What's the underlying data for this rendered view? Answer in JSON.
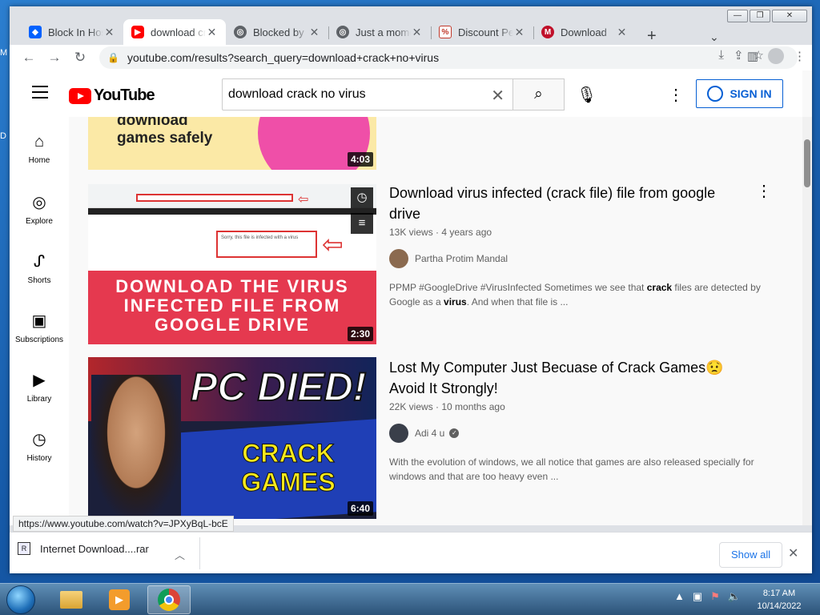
{
  "browser": {
    "tabs": [
      {
        "title": "Block In Host",
        "favicon": "dropbox-icon",
        "active": false
      },
      {
        "title": "download crack no virus",
        "favicon": "youtube-icon",
        "active": true
      },
      {
        "title": "Blocked by",
        "favicon": "globe-icon",
        "active": false
      },
      {
        "title": "Just a moment",
        "favicon": "globe-icon",
        "active": false
      },
      {
        "title": "Discount Pe",
        "favicon": "discount-icon",
        "active": false
      },
      {
        "title": "Download",
        "favicon": "m-icon",
        "active": false
      }
    ],
    "address": "youtube.com/results?search_query=download+crack+no+virus",
    "status_url": "https://www.youtube.com/watch?v=JPXyBqL-bcE"
  },
  "youtube": {
    "logo_text": "YouTube",
    "search_value": "download crack no virus",
    "signin_label": "SIGN IN",
    "guide": [
      {
        "label": "Home",
        "icon": "home-icon"
      },
      {
        "label": "Explore",
        "icon": "compass-icon"
      },
      {
        "label": "Shorts",
        "icon": "shorts-icon"
      },
      {
        "label": "Subscriptions",
        "icon": "subscriptions-icon"
      },
      {
        "label": "Library",
        "icon": "library-icon"
      },
      {
        "label": "History",
        "icon": "history-icon"
      }
    ],
    "results": [
      {
        "thumb_text": "download\ngames safely",
        "duration": "4:03"
      },
      {
        "title": "Download virus infected (crack file) file from google drive",
        "meta": "13K views · 4 years ago",
        "channel": "Partha Protim Mandal",
        "desc_1": "PPMP #GoogleDrive #VirusInfected Sometimes we see that ",
        "desc_b1": "crack",
        "desc_2": " files are detected by Google as a ",
        "desc_b2": "virus",
        "desc_3": ". And when that file is ...",
        "thumb_banner": "DOWNLOAD THE VIRUS INFECTED FILE FROM GOOGLE DRIVE",
        "thumb_notice": "Sorry, this file is infected with a virus",
        "duration": "2:30"
      },
      {
        "title": "Lost My Computer Just Becuase of Crack Games😟 Avoid It Strongly!",
        "meta": "22K views · 10 months ago",
        "channel": "Adi 4 u",
        "desc": "With the evolution of windows, we all notice that games are also released specially for windows and that are too heavy even ...",
        "thumb_text_1": "PC DIED!",
        "thumb_text_2": "CRACK GAMES",
        "duration": "6:40"
      }
    ]
  },
  "downloads": {
    "file": "Internet Download....rar",
    "show_all": "Show all"
  },
  "taskbar": {
    "time": "8:17 AM",
    "date": "10/14/2022"
  }
}
